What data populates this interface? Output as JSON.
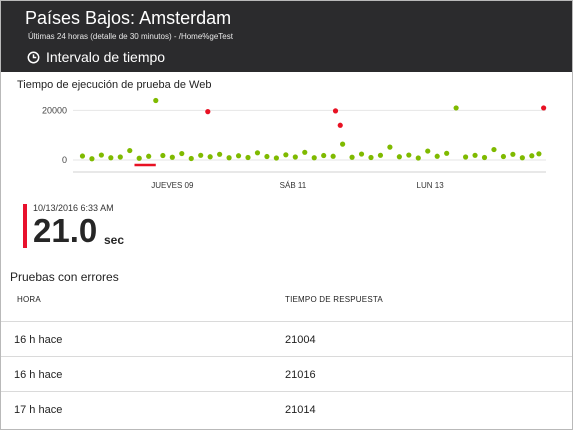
{
  "header": {
    "title": "Países Bajos: Amsterdam",
    "subtitle": "Últimas 24 horas (detalle de 30 minutos) - /Home%geTest",
    "time_range_label": "Intervalo de tiempo",
    "time_range_icon": "clock-icon",
    "background_color": "#2b2b2d"
  },
  "chart_data": {
    "type": "scatter",
    "title": "Tiempo de ejecución de prueba de Web",
    "y_tick_labels": [
      "20000",
      "0"
    ],
    "x_tick_labels": [
      "JUEVES 09",
      "SÁB 11",
      "LUN 13"
    ],
    "ylim": [
      0,
      25000
    ],
    "grid": true,
    "series": [
      {
        "color": "#7fba00",
        "points": [
          {
            "x": 0.02,
            "y": 1600
          },
          {
            "x": 0.04,
            "y": 500
          },
          {
            "x": 0.06,
            "y": 2000
          },
          {
            "x": 0.08,
            "y": 900
          },
          {
            "x": 0.1,
            "y": 1200
          },
          {
            "x": 0.12,
            "y": 3800
          },
          {
            "x": 0.14,
            "y": 700
          },
          {
            "x": 0.16,
            "y": 1500
          },
          {
            "x": 0.175,
            "y": 24000
          },
          {
            "x": 0.19,
            "y": 1800
          },
          {
            "x": 0.21,
            "y": 1100
          },
          {
            "x": 0.23,
            "y": 2600
          },
          {
            "x": 0.25,
            "y": 600
          },
          {
            "x": 0.27,
            "y": 1900
          },
          {
            "x": 0.29,
            "y": 1300
          },
          {
            "x": 0.31,
            "y": 2300
          },
          {
            "x": 0.33,
            "y": 900
          },
          {
            "x": 0.35,
            "y": 1700
          },
          {
            "x": 0.37,
            "y": 1000
          },
          {
            "x": 0.39,
            "y": 2900
          },
          {
            "x": 0.41,
            "y": 1400
          },
          {
            "x": 0.43,
            "y": 800
          },
          {
            "x": 0.45,
            "y": 2100
          },
          {
            "x": 0.47,
            "y": 1200
          },
          {
            "x": 0.49,
            "y": 3100
          },
          {
            "x": 0.51,
            "y": 900
          },
          {
            "x": 0.53,
            "y": 1800
          },
          {
            "x": 0.55,
            "y": 1500
          },
          {
            "x": 0.57,
            "y": 6400
          },
          {
            "x": 0.59,
            "y": 1100
          },
          {
            "x": 0.61,
            "y": 2400
          },
          {
            "x": 0.63,
            "y": 1000
          },
          {
            "x": 0.65,
            "y": 1900
          },
          {
            "x": 0.67,
            "y": 5200
          },
          {
            "x": 0.69,
            "y": 1300
          },
          {
            "x": 0.71,
            "y": 2000
          },
          {
            "x": 0.73,
            "y": 800
          },
          {
            "x": 0.75,
            "y": 3600
          },
          {
            "x": 0.77,
            "y": 1500
          },
          {
            "x": 0.79,
            "y": 2700
          },
          {
            "x": 0.81,
            "y": 21000
          },
          {
            "x": 0.83,
            "y": 1200
          },
          {
            "x": 0.85,
            "y": 1900
          },
          {
            "x": 0.87,
            "y": 1000
          },
          {
            "x": 0.89,
            "y": 4200
          },
          {
            "x": 0.91,
            "y": 1400
          },
          {
            "x": 0.93,
            "y": 2300
          },
          {
            "x": 0.95,
            "y": 900
          },
          {
            "x": 0.97,
            "y": 1700
          },
          {
            "x": 0.985,
            "y": 2500
          }
        ]
      },
      {
        "color": "#e81123",
        "points": [
          {
            "x": 0.285,
            "y": 19500
          },
          {
            "x": 0.555,
            "y": 19800
          },
          {
            "x": 0.565,
            "y": 14000
          },
          {
            "x": 0.995,
            "y": 21000
          }
        ]
      }
    ],
    "failure_segment": {
      "x_start": 0.13,
      "x_end": 0.175,
      "color": "#e81123"
    }
  },
  "metric": {
    "timestamp": "10/13/2016 6:33 AM",
    "value": "21.0",
    "unit": "sec",
    "accent_color": "#e8112d"
  },
  "failures": {
    "title": "Pruebas con errores",
    "columns": [
      "HORA",
      "TIEMPO DE RESPUESTA"
    ],
    "rows": [
      {
        "time": "16 h hace",
        "response": "21004"
      },
      {
        "time": "16 h hace",
        "response": "21016"
      },
      {
        "time": "17 h hace",
        "response": "21014"
      }
    ]
  }
}
